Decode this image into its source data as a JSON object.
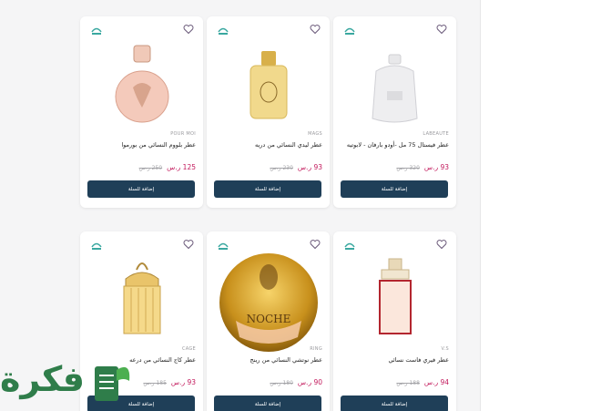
{
  "products": [
    {
      "brand": "LABEAUTE",
      "title": "عطر فيستال 75 مل -أودو بارفان - لابوتيه",
      "price": "93 ر.س",
      "old_price": "320 ر.س",
      "button": "إضافة للسلة"
    },
    {
      "brand": "MAGS",
      "title": "عطر ليدي النسائي من دريه",
      "price": "93 ر.س",
      "old_price": "230 ر.س",
      "button": "إضافة للسلة"
    },
    {
      "brand": "POUR MOI",
      "title": "عطر بلووم النسائي من بورموا",
      "price": "125 ر.س",
      "old_price": "250 ر.س",
      "button": "إضافة للسلة"
    },
    {
      "brand": "V.S",
      "title": "عطر فيري فاست نسائي",
      "price": "94 ر.س",
      "old_price": "188 ر.س",
      "button": "إضافة للسلة"
    },
    {
      "brand": "RING",
      "title": "عطر نوتشي النسائي من رينج",
      "price": "90 ر.س",
      "old_price": "180 ر.س",
      "button": "إضافة للسلة"
    },
    {
      "brand": "CAGE",
      "title": "عطر كاج النسائي من درعه",
      "price": "93 ر.س",
      "old_price": "185 ر.س",
      "button": "إضافة للسلة"
    }
  ],
  "watermark": {
    "text": "فكرة"
  },
  "colors": {
    "button_bg": "#1f3f58",
    "price": "#c2185b",
    "watermark": "#2f7d4a"
  }
}
